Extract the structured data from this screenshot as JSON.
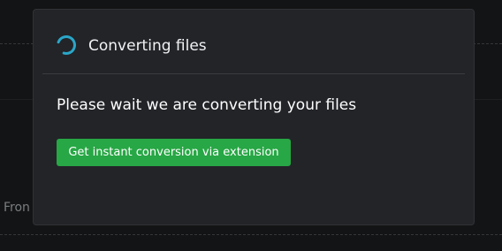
{
  "modal": {
    "icon": "loading-spinner-icon",
    "title": "Converting files",
    "message": "Please wait we are converting your files",
    "cta_label": "Get instant conversion via extension"
  },
  "backdrop": {
    "partial_text": "Fron"
  },
  "colors": {
    "accent_spinner": "#2aa6c8",
    "button_green": "#27a745",
    "modal_bg": "#222428",
    "page_bg": "#131415"
  }
}
